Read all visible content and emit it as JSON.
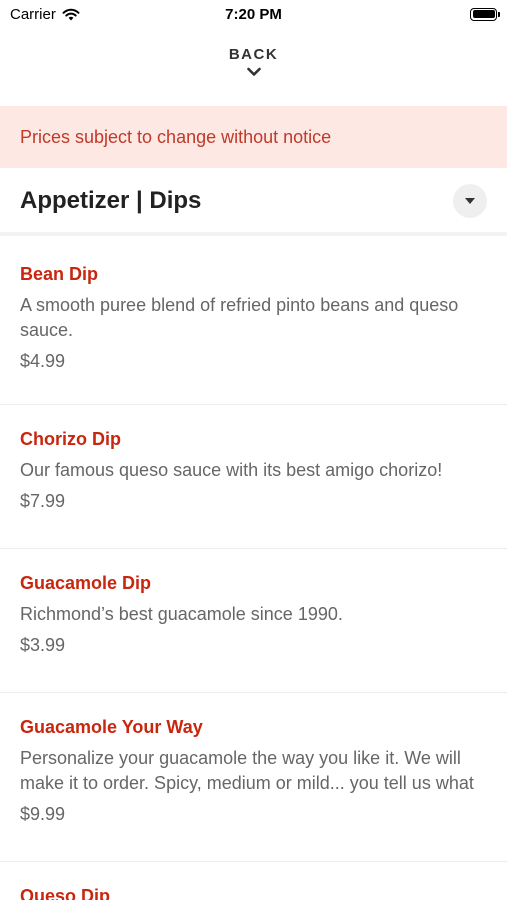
{
  "status_bar": {
    "carrier": "Carrier",
    "time": "7:20 PM"
  },
  "nav": {
    "back_label": "BACK"
  },
  "notice": {
    "text": "Prices subject to change without notice"
  },
  "category": {
    "title": "Appetizer | Dips"
  },
  "items": [
    {
      "name": "Bean Dip",
      "description": "A smooth puree blend of refried pinto beans and queso sauce.",
      "price": "$4.99"
    },
    {
      "name": "Chorizo Dip",
      "description": "Our famous queso sauce with its best amigo chorizo!",
      "price": "$7.99"
    },
    {
      "name": "Guacamole Dip",
      "description": "Richmond’s best guacamole since 1990.",
      "price": "$3.99"
    },
    {
      "name": "Guacamole Your Way",
      "description": "Personalize your guacamole the way you like it. We will make it to order. Spicy, medium or mild... you tell us what",
      "price": "$9.99"
    },
    {
      "name": "Queso Dip"
    }
  ],
  "icons": {
    "wifi": "wifi-icon",
    "battery": "battery-icon",
    "back_chevron": "chevron-down-icon",
    "category_toggle": "chevron-down-icon"
  },
  "colors": {
    "accent": "#c8260f",
    "notice_bg": "#fde8e3",
    "notice_text": "#c0392b"
  }
}
